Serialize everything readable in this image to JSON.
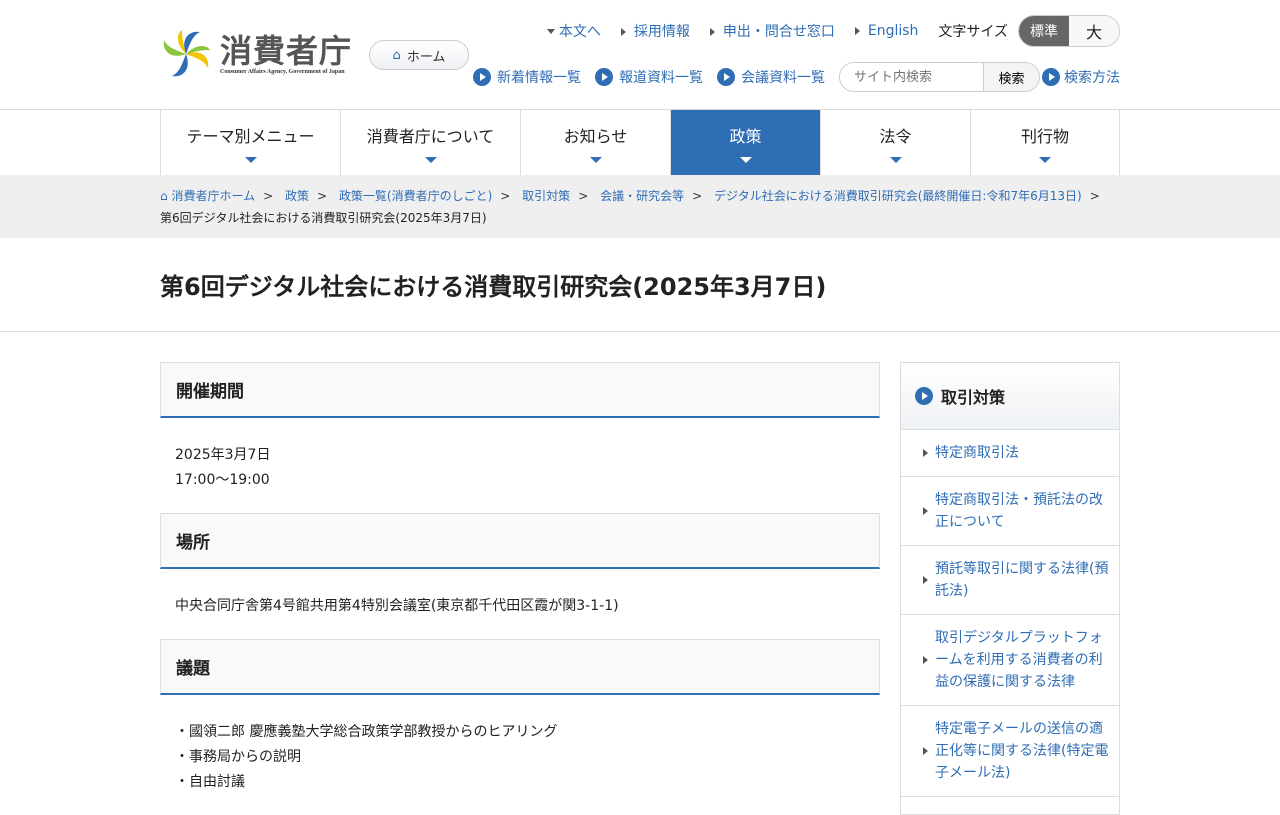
{
  "header": {
    "logo_jp": "消費者庁",
    "logo_en": "Consumer Affairs Agency, Government of Japan",
    "home": "ホーム",
    "top_links": [
      "本文へ",
      "採用情報",
      "申出・問合せ窓口",
      "English"
    ],
    "font_size_label": "文字サイズ",
    "font_standard": "標準",
    "font_large": "大",
    "second_links": [
      "新着情報一覧",
      "報道資料一覧",
      "会議資料一覧"
    ],
    "search_placeholder": "サイト内検索",
    "search_button": "検索",
    "search_help": "検索方法"
  },
  "nav": [
    "テーマ別メニュー",
    "消費者庁について",
    "お知らせ",
    "政策",
    "法令",
    "刊行物"
  ],
  "breadcrumb": [
    "消費者庁ホーム",
    "政策",
    "政策一覧(消費者庁のしごと)",
    "取引対策",
    "会議・研究会等",
    "デジタル社会における消費取引研究会(最終開催日:令和7年6月13日)"
  ],
  "breadcrumb_current": "第6回デジタル社会における消費取引研究会(2025年3月7日)",
  "title": "第6回デジタル社会における消費取引研究会(2025年3月7日)",
  "sections": {
    "period": {
      "heading": "開催期間",
      "date": "2025年3月7日",
      "time": "17:00～19:00"
    },
    "place": {
      "heading": "場所",
      "text": "中央合同庁舎第4号館共用第4特別会議室(東京都千代田区霞が関3-1-1)"
    },
    "agenda": {
      "heading": "議題",
      "items": [
        "・國領二郎 慶應義塾大学総合政策学部教授からのヒアリング",
        "・事務局からの説明",
        "・自由討議"
      ]
    }
  },
  "sidebar": {
    "heading": "取引対策",
    "items": [
      "特定商取引法",
      "特定商取引法・預託法の改正について",
      "預託等取引に関する法律(預託法)",
      "取引デジタルプラットフォームを利用する消費者の利益の保護に関する法律",
      "特定電子メールの送信の適正化等に関する法律(特定電子メール法)"
    ]
  }
}
